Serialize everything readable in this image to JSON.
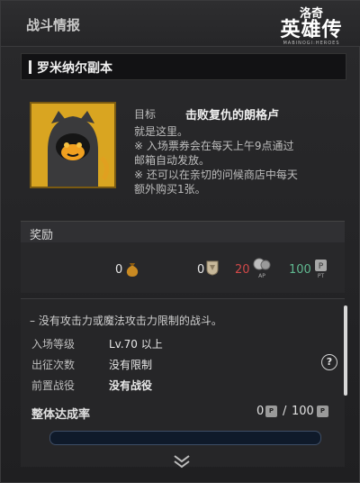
{
  "header": {
    "title": "战斗情报"
  },
  "logo": {
    "line1": "洛奇",
    "line2": "英雄传",
    "line3": "MABINOGI:HEROES"
  },
  "dungeon": {
    "name": "罗米纳尔副本"
  },
  "mission": {
    "goal_label": "目标",
    "goal_value": "击败复仇的朗格卢",
    "desc": [
      "就是这里。",
      "※ 入场票券会在每天上午9点通过",
      "邮箱自动发放。",
      "※ 还可以在亲切的问候商店中每天",
      "额外购买1张。"
    ]
  },
  "rewards": {
    "label": "奖励",
    "gold": "0",
    "medal": "0",
    "ap": "20",
    "ap_tag": "AP",
    "pt": "100",
    "pt_tag": "PT"
  },
  "conditions": {
    "note": "– 没有攻击力或魔法攻击力限制的战斗。",
    "rows": [
      {
        "label": "入场等级",
        "value": "Lv.70 以上"
      },
      {
        "label": "出征次数",
        "value": "没有限制"
      },
      {
        "label": "前置战役",
        "value": "没有战役"
      }
    ],
    "help": "?"
  },
  "achievement": {
    "label": "整体达成率",
    "current": "0",
    "sep": "/",
    "total": "100",
    "pt_tag": "PT",
    "progress": 0
  }
}
